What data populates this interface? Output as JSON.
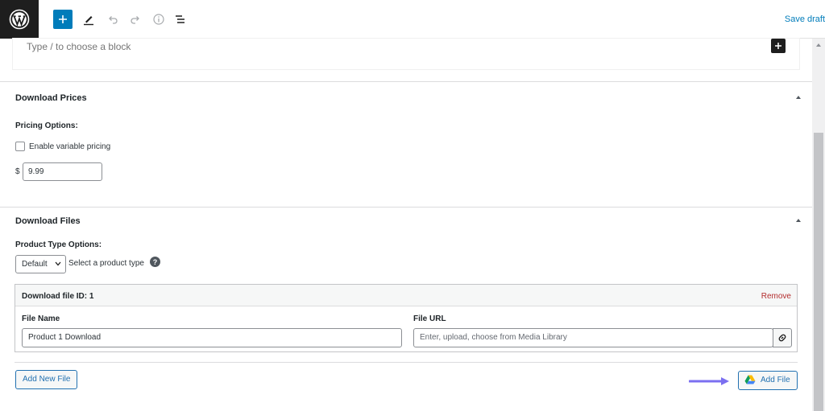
{
  "toolbar": {
    "save_draft": "Save draft",
    "icons": [
      "wordpress-logo",
      "plus-icon",
      "pencil-icon",
      "undo-icon",
      "redo-icon",
      "info-icon",
      "list-view-icon"
    ],
    "accent": "#007cba"
  },
  "editor": {
    "placeholder": "Type / to choose a block"
  },
  "download_prices": {
    "title": "Download Prices",
    "pricing_options_label": "Pricing Options:",
    "variable_pricing_label": "Enable variable pricing",
    "variable_pricing_checked": false,
    "currency_symbol": "$",
    "price_value": "9.99"
  },
  "download_files": {
    "title": "Download Files",
    "product_type_label": "Product Type Options:",
    "product_type_selected": "Default",
    "product_type_hint": "Select a product type",
    "help_glyph": "?",
    "file_row": {
      "id_label": "Download file ID: 1",
      "remove_label": "Remove",
      "file_name_label": "File Name",
      "file_name_value": "Product 1 Download",
      "file_url_label": "File URL",
      "file_url_placeholder": "Enter, upload, choose from Media Library"
    },
    "add_new_file_label": "Add New File",
    "add_file_label": "Add File"
  },
  "colors": {
    "link_blue": "#2271b1",
    "remove_red": "#b32d2e",
    "annotation_arrow": "#7b6ff0"
  }
}
